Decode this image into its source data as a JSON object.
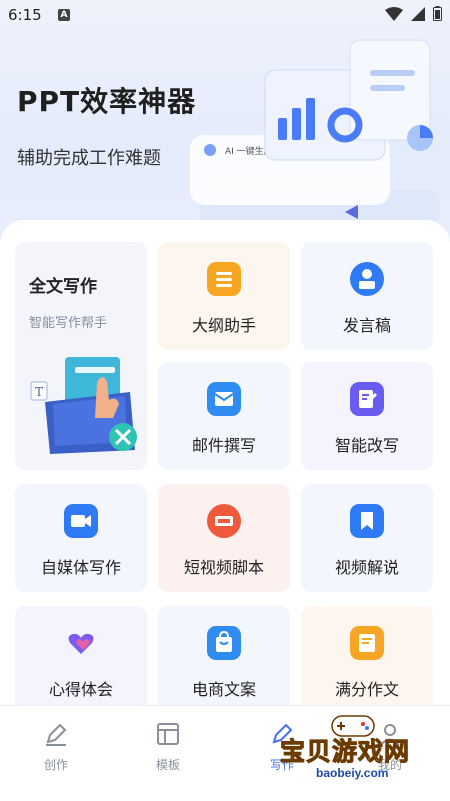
{
  "status": {
    "time": "6:15",
    "notif": "A"
  },
  "hero": {
    "title": "PPT效率神器",
    "subtitle": "辅助完成工作难题",
    "art_text": "AI 一键生成 PPT"
  },
  "feature": {
    "title": "全文写作",
    "subtitle": "智能写作帮手"
  },
  "cards": [
    {
      "label": "大纲助手",
      "icon": "outline-icon",
      "color": "#f6a623"
    },
    {
      "label": "发言稿",
      "icon": "speaker-icon",
      "color": "#2f7af5"
    },
    {
      "label": "邮件撰写",
      "icon": "mail-icon",
      "color": "#2f8cf0"
    },
    {
      "label": "智能改写",
      "icon": "rewrite-icon",
      "color": "#6a5cf0"
    },
    {
      "label": "自媒体写作",
      "icon": "video-camera-icon",
      "color": "#2f7af5"
    },
    {
      "label": "短视频脚本",
      "icon": "script-icon",
      "color": "#f05a3c"
    },
    {
      "label": "视频解说",
      "icon": "bookmark-icon",
      "color": "#2f7af5"
    },
    {
      "label": "心得体会",
      "icon": "heart-icon",
      "color": "#7b5cf0"
    },
    {
      "label": "电商文案",
      "icon": "shopping-bag-icon",
      "color": "#2f8cf0"
    },
    {
      "label": "满分作文",
      "icon": "essay-icon",
      "color": "#f6a623"
    }
  ],
  "tabs": [
    {
      "label": "创作",
      "icon": "pen-icon"
    },
    {
      "label": "模板",
      "icon": "template-icon"
    },
    {
      "label": "写作",
      "icon": "write-icon"
    },
    {
      "label": "我的",
      "icon": "profile-icon"
    }
  ],
  "watermark": {
    "text": "宝贝游戏网",
    "url": "baobeiy.com"
  }
}
